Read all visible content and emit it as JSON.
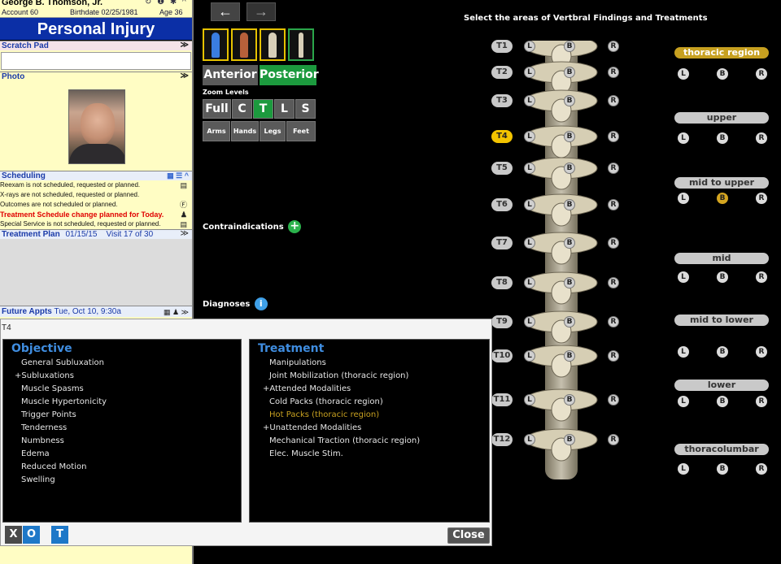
{
  "patient": {
    "name": "George B. Thomson, Jr.",
    "account": "Account 60",
    "birthdate": "Birthdate 02/25/1981",
    "age": "Age 36",
    "header_icons": "↻ ❶ ✱ ^"
  },
  "banner": "Personal Injury",
  "scratch_pad": {
    "label": "Scratch Pad"
  },
  "photo": {
    "label": "Photo"
  },
  "scheduling": {
    "label": "Scheduling",
    "lines": [
      {
        "text": "Reexam is not scheduled, requested or planned.",
        "icon": "calendar-icon"
      },
      {
        "text": "X-rays are not scheduled, requested or planned.",
        "icon": ""
      },
      {
        "text": "Outcomes are not scheduled or planned.",
        "icon": "outcome-icon"
      },
      {
        "text": "Treatment Schedule change planned for Today.",
        "icon": "stamp-icon"
      },
      {
        "text": "Special Service is not scheduled, requested or planned.",
        "icon": "calendar-icon"
      }
    ]
  },
  "treatment_plan": {
    "label": "Treatment Plan",
    "date": "01/15/15",
    "visit": "Visit 17 of 30"
  },
  "future_appts": {
    "label": "Future Appts",
    "value": "Tue, Oct 10,  9:30a"
  },
  "nav": {
    "back": "←",
    "forward": "→"
  },
  "views": {
    "anterior": "Anterior",
    "posterior": "Posterior"
  },
  "zoom": {
    "label": "Zoom Levels",
    "levels": [
      "Full",
      "C",
      "T",
      "L",
      "S"
    ],
    "selected": "T",
    "limbs": [
      "Arms",
      "Hands",
      "Legs",
      "Feet"
    ]
  },
  "contraindications": "Contraindications",
  "diagnoses": "Diagnoses",
  "spine": {
    "title": "Select the areas of Vertbral Findings and Treatments",
    "vertebrae": [
      "T1",
      "T2",
      "T3",
      "T4",
      "T5",
      "T6",
      "T7",
      "T8",
      "T9",
      "T10",
      "T11",
      "T12"
    ],
    "selected": "T4",
    "side_letters": [
      "L",
      "B",
      "R"
    ]
  },
  "regions": {
    "items": [
      "thoracic region",
      "upper",
      "mid to upper",
      "mid",
      "mid to lower",
      "lower",
      "thoracolumbar"
    ],
    "selected": "thoracic region",
    "selected_button": "B",
    "selected_button_region": "mid to upper"
  },
  "dialog": {
    "title": "T4",
    "objective": {
      "title": "Objective",
      "items": [
        "General Subluxation",
        "+Subluxations",
        "Muscle Spasms",
        "Muscle Hypertonicity",
        "Trigger Points",
        "Tenderness",
        "Numbness",
        "Edema",
        "Reduced Motion",
        "Swelling"
      ]
    },
    "treatment": {
      "title": "Treatment",
      "items": [
        "Manipulations",
        "Joint Mobilization (thoracic region)",
        "+Attended Modalities",
        "Cold Packs (thoracic region)",
        "Hot Packs (thoracic region)",
        "+Unattended Modalities",
        "Mechanical Traction (thoracic region)",
        "Elec. Muscle Stim."
      ],
      "highlighted": "Hot Packs (thoracic region)"
    },
    "tabs": [
      "X",
      "O",
      "T"
    ],
    "close": "Close"
  },
  "colors": {
    "banner": "#0b2fa6",
    "zoom_on": "#1c9a3e",
    "accent_gold": "#c7a020",
    "pane_title": "#3f8de0"
  }
}
